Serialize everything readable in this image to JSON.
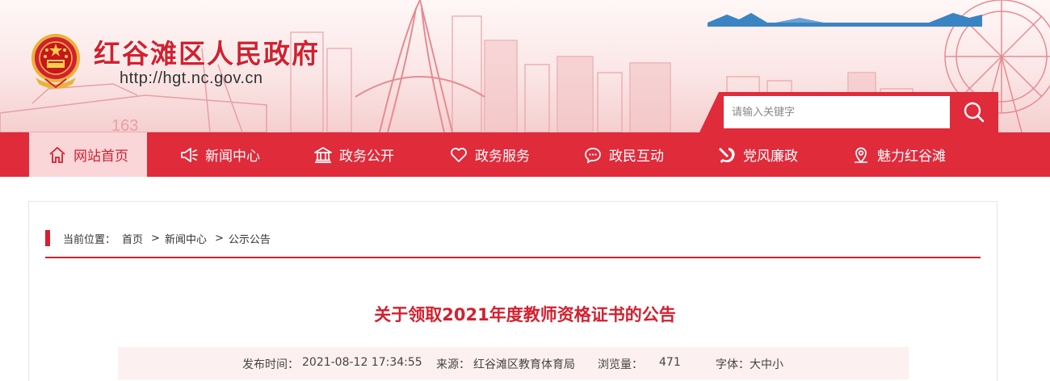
{
  "header": {
    "site_title": "红谷滩区人民政府",
    "site_url": "http://hgt.nc.gov.cn",
    "emblem_icon": "national-emblem-icon"
  },
  "search": {
    "placeholder": "请输入关键字",
    "button_icon": "search-icon"
  },
  "nav": {
    "items": [
      {
        "label": "网站首页",
        "icon": "home-icon",
        "active": true
      },
      {
        "label": "新闻中心",
        "icon": "megaphone-icon",
        "active": false
      },
      {
        "label": "政务公开",
        "icon": "government-building-icon",
        "active": false
      },
      {
        "label": "政务服务",
        "icon": "heart-icon",
        "active": false
      },
      {
        "label": "政民互动",
        "icon": "chat-bubble-icon",
        "active": false
      },
      {
        "label": "党风廉政",
        "icon": "party-emblem-icon",
        "active": false
      },
      {
        "label": "魅力红谷滩",
        "icon": "location-pin-icon",
        "active": false
      }
    ]
  },
  "breadcrumb": {
    "label": "当前位置：",
    "items": [
      "首页",
      "新闻中心",
      "公示公告"
    ],
    "separator": ">"
  },
  "article": {
    "title": "关于领取2021年度教师资格证书的公告",
    "publish_time_label": "发布时间：",
    "publish_time": "2021-08-12 17:34:55",
    "source_label": "来源：",
    "source": "红谷滩区教育体育局",
    "views_label": "浏览量：",
    "views": "471",
    "font_label": "字体：",
    "font_sizes": [
      "大",
      "中",
      "小"
    ]
  },
  "colors": {
    "accent_red": "#e02b3b",
    "title_red": "#d4202e",
    "nav_active_bg": "#fad6d9",
    "meta_bg": "#fdf0f0"
  }
}
